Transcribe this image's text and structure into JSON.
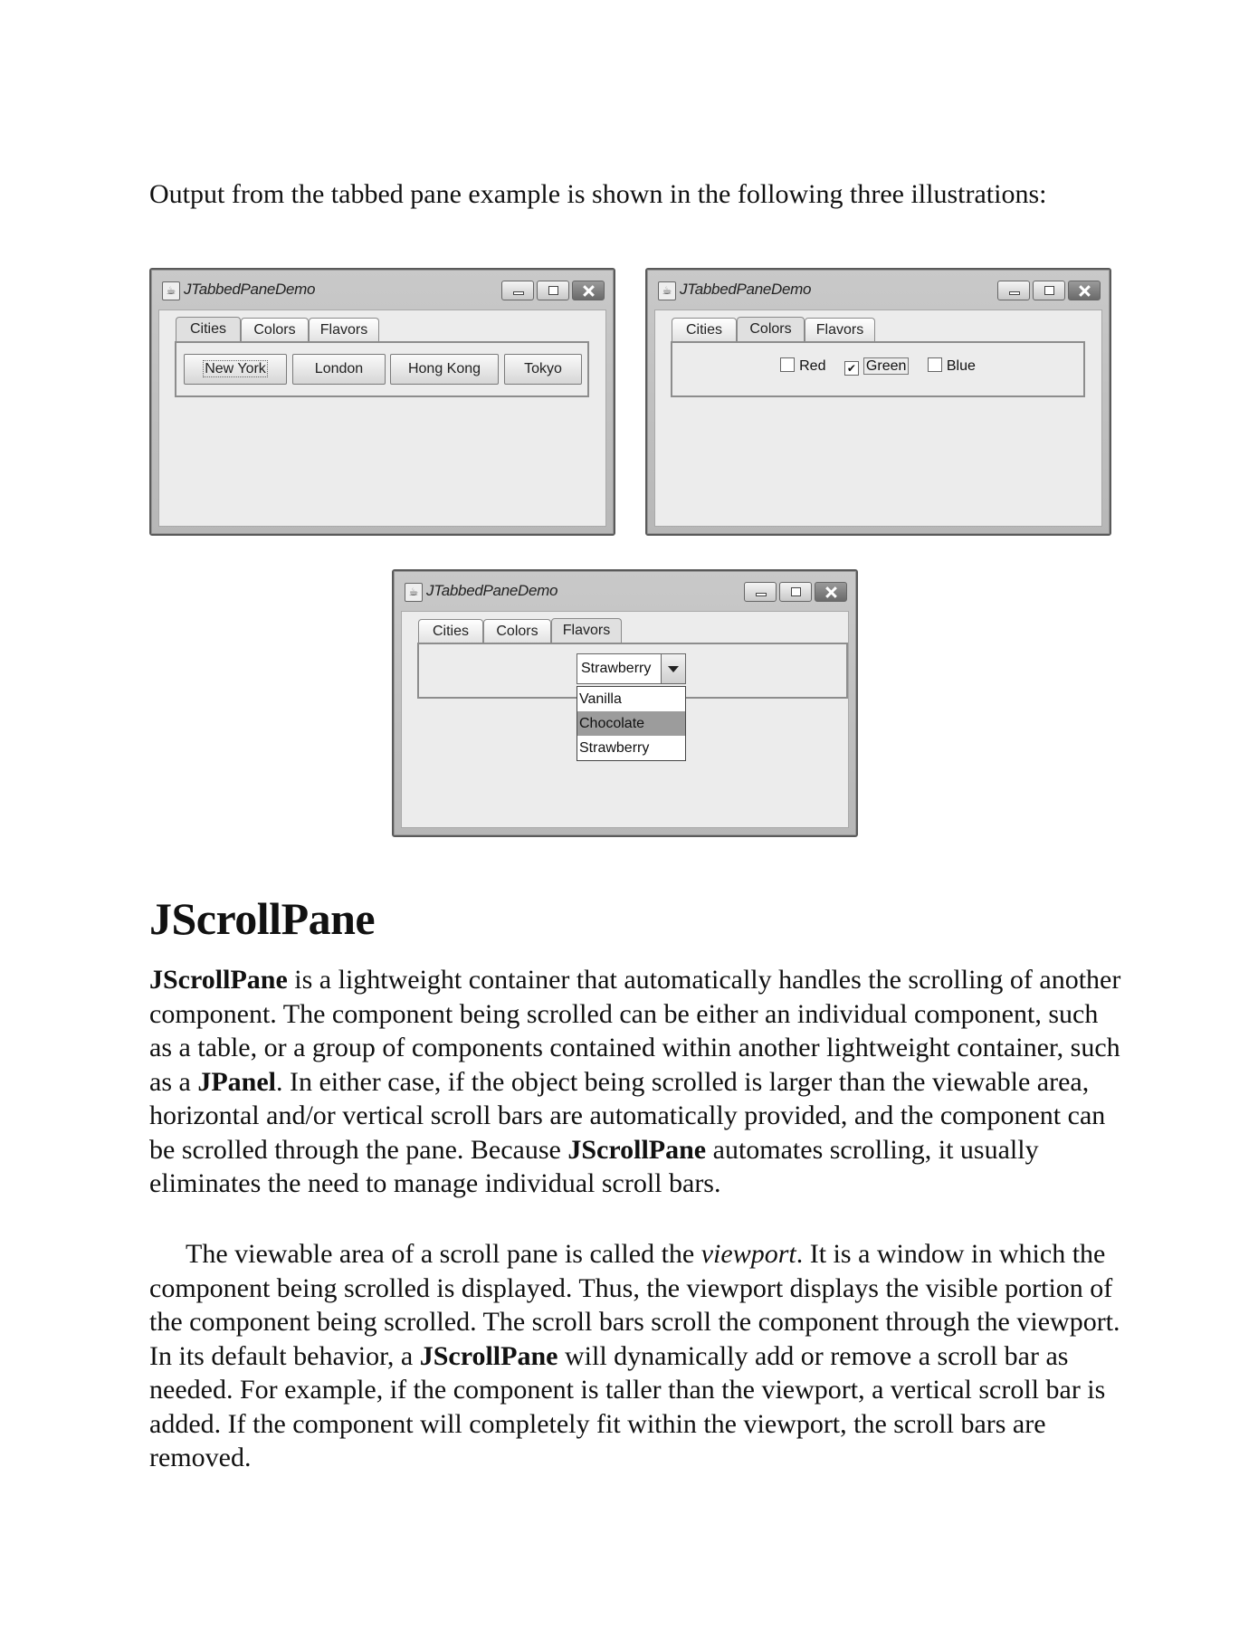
{
  "intro": "Output from the tabbed pane example is shown in the following three illustrations:",
  "window_title": "JTabbedPaneDemo",
  "tabs": [
    "Cities",
    "Colors",
    "Flavors"
  ],
  "cities": [
    "New York",
    "London",
    "Hong Kong",
    "Tokyo"
  ],
  "colors": [
    {
      "label": "Red",
      "checked": false
    },
    {
      "label": "Green",
      "checked": true
    },
    {
      "label": "Blue",
      "checked": false
    }
  ],
  "flavors": {
    "selected": "Strawberry",
    "options": [
      "Vanilla",
      "Chocolate",
      "Strawberry"
    ],
    "highlighted": "Chocolate"
  },
  "check_mark": "✔",
  "heading": "JScrollPane",
  "p1": {
    "b1": "JScrollPane",
    "t1": " is a lightweight container that automatically handles the scrolling of another component. The component being scrolled can be either an individual component, such as a table, or a group of components contained within another lightweight container, such as a ",
    "b2": "JPanel",
    "t2": ". In either case, if the object being scrolled is larger than the viewable area, horizontal and/or vertical scroll bars are automatically provided, and the component can be scrolled through the pane. Because ",
    "b3": "JScrollPane",
    "t3": " automates scrolling, it usually eliminates the need to manage individual scroll bars."
  },
  "p2": {
    "t1": "The viewable area of a scroll pane is called the ",
    "i1": "viewport",
    "t2": ". It is a window in which the component being scrolled is displayed. Thus, the viewport displays the visible portion of the component being scrolled. The scroll bars scroll the component through the viewport. In its default behavior, a ",
    "b1": "JScrollPane",
    "t3": " will dynamically add or remove a scroll bar as needed. For example, if the component is taller than the viewport, a vertical scroll bar is added. If the component will completely fit within the viewport, the scroll bars are removed."
  }
}
